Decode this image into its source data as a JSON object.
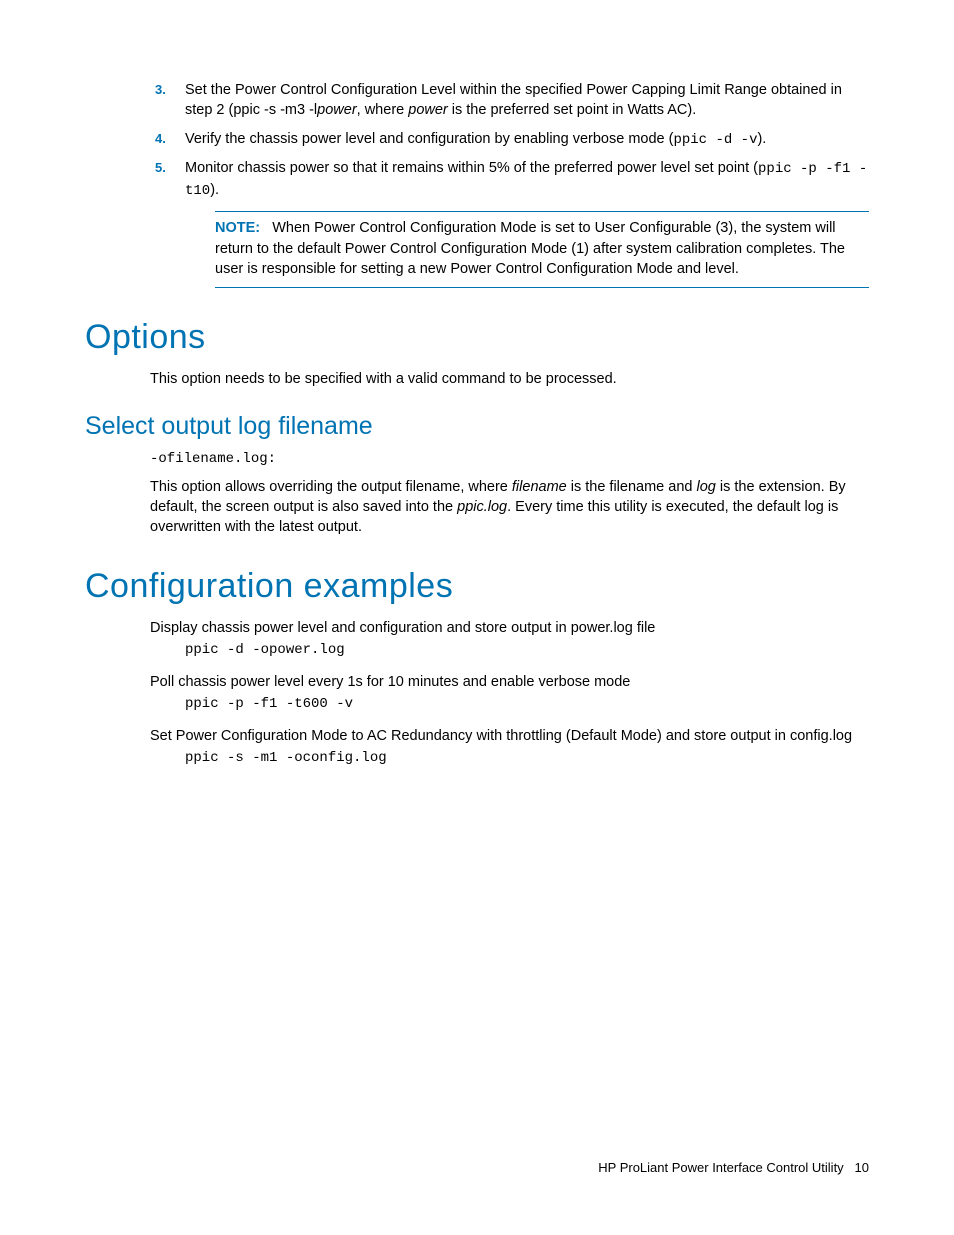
{
  "steps": {
    "s3": {
      "num": "3.",
      "text_a": "Set the Power Control Configuration Level within the specified Power Capping Limit Range obtained in step 2 (ppic -s -m3 -l",
      "italic1": "power",
      "text_b": ", where ",
      "italic2": "power",
      "text_c": " is the preferred set point in Watts AC)."
    },
    "s4": {
      "num": "4.",
      "text_a": "Verify the chassis power level and configuration by enabling verbose mode (",
      "code": "ppic -d -v",
      "text_b": ")."
    },
    "s5": {
      "num": "5.",
      "text_a": "Monitor chassis power so that it remains within 5% of the preferred power level set point (",
      "code": "ppic -p -f1 -t10",
      "text_b": ")."
    }
  },
  "note": {
    "label": "NOTE:",
    "text": "When Power Control Configuration Mode is set to User Configurable (3), the system will return to the default Power Control Configuration Mode (1) after system calibration completes. The user is responsible for setting a new Power Control Configuration Mode and level."
  },
  "options": {
    "heading": "Options",
    "intro": "This option needs to be specified with a valid command to be processed."
  },
  "select_log": {
    "heading": "Select output log filename",
    "code": "-ofilename.log:",
    "p_a": "This option allows overriding the output filename, where ",
    "italic1": "filename",
    "p_b": " is the filename and ",
    "italic2": "log",
    "p_c": " is the extension. By default, the screen output is also saved into the ",
    "italic3": "ppic.log",
    "p_d": ". Every time this utility is executed, the default log is overwritten with the latest output."
  },
  "config": {
    "heading": "Configuration examples",
    "ex1": {
      "desc": "Display chassis power level and configuration and store output in power.log file",
      "code": "ppic -d -opower.log"
    },
    "ex2": {
      "desc": "Poll chassis power level every 1s for 10 minutes and enable verbose mode",
      "code": "ppic -p -f1 -t600 -v"
    },
    "ex3": {
      "desc": "Set Power Configuration Mode to AC Redundancy with throttling (Default Mode) and store output in config.log",
      "code": "ppic -s -m1 -oconfig.log"
    }
  },
  "footer": {
    "title": "HP ProLiant Power Interface Control Utility",
    "page": "10"
  }
}
